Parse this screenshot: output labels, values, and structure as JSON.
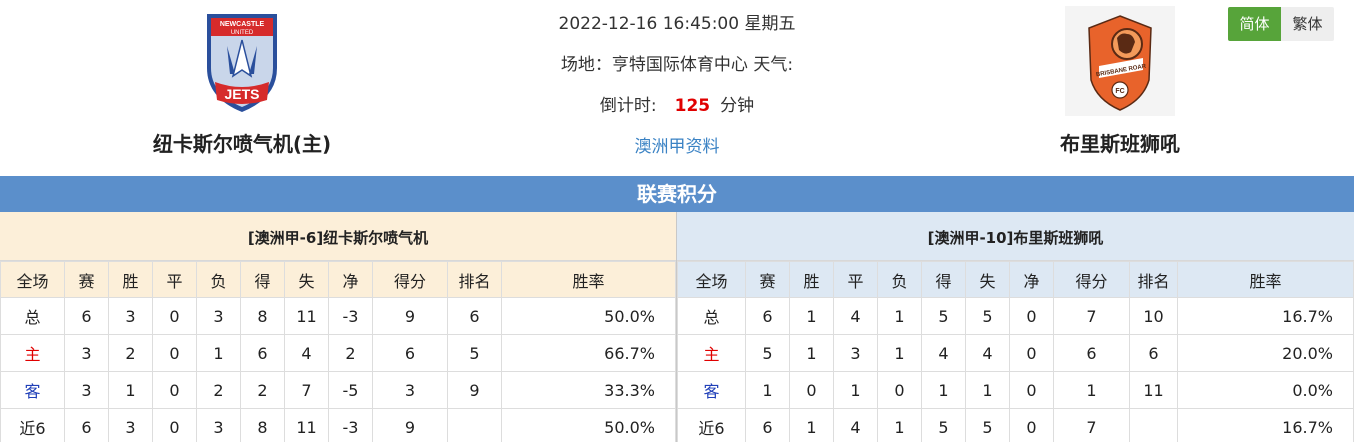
{
  "match": {
    "datetime": "2022-12-16 16:45:00 星期五",
    "venue_label": "场地：",
    "venue_value": "亨特国际体育中心",
    "weather_label": "天气:",
    "countdown_label": "倒计时:",
    "countdown_value": "125",
    "countdown_unit": "分钟",
    "league_link": "澳洲甲资料"
  },
  "home_team": {
    "name": "纽卡斯尔喷气机(主)",
    "logo_text_top": "NEWCASTLE",
    "logo_text_mid": "UNITED",
    "logo_text_bottom": "JETS",
    "colors": {
      "red": "#d62b2b",
      "blue": "#2a4f9c",
      "white": "#ffffff"
    }
  },
  "away_team": {
    "name": "布里斯班狮吼",
    "logo_text": "BRISBANE ROAR",
    "logo_badge": "FC",
    "colors": {
      "orange": "#e8632b",
      "dark": "#5a2a14"
    }
  },
  "lang": {
    "simplified": "简体",
    "traditional": "繁体",
    "active_color": "#57a43a"
  },
  "banner": {
    "title": "联赛积分",
    "color": "#5b8fcb"
  },
  "headers": [
    "全场",
    "赛",
    "胜",
    "平",
    "负",
    "得",
    "失",
    "净",
    "得分",
    "排名",
    "胜率"
  ],
  "home_panel": {
    "title": "[澳洲甲-6]纽卡斯尔喷气机",
    "rows": [
      [
        "总",
        "6",
        "3",
        "0",
        "3",
        "8",
        "11",
        "-3",
        "9",
        "6",
        "50.0%"
      ],
      [
        "主",
        "3",
        "2",
        "0",
        "1",
        "6",
        "4",
        "2",
        "6",
        "5",
        "66.7%"
      ],
      [
        "客",
        "3",
        "1",
        "0",
        "2",
        "2",
        "7",
        "-5",
        "3",
        "9",
        "33.3%"
      ],
      [
        "近6",
        "6",
        "3",
        "0",
        "3",
        "8",
        "11",
        "-3",
        "9",
        "",
        "50.0%"
      ]
    ]
  },
  "away_panel": {
    "title": "[澳洲甲-10]布里斯班狮吼",
    "rows": [
      [
        "总",
        "6",
        "1",
        "4",
        "1",
        "5",
        "5",
        "0",
        "7",
        "10",
        "16.7%"
      ],
      [
        "主",
        "5",
        "1",
        "3",
        "1",
        "4",
        "4",
        "0",
        "6",
        "6",
        "20.0%"
      ],
      [
        "客",
        "1",
        "0",
        "1",
        "0",
        "1",
        "1",
        "0",
        "1",
        "11",
        "0.0%"
      ],
      [
        "近6",
        "6",
        "1",
        "4",
        "1",
        "5",
        "5",
        "0",
        "7",
        "",
        "16.7%"
      ]
    ]
  }
}
